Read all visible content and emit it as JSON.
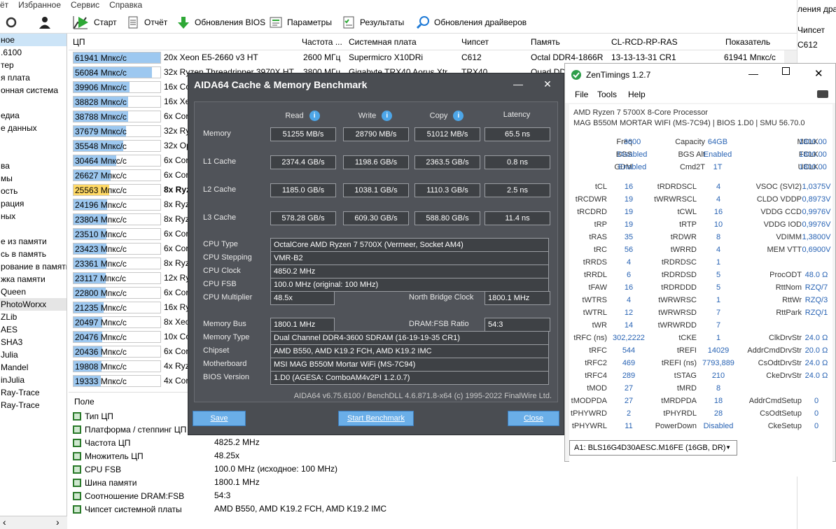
{
  "menu": [
    "ёт",
    "Избранное",
    "Сервис",
    "Справка"
  ],
  "toolbar": [
    {
      "label": "Старт",
      "icon": "play-icon"
    },
    {
      "label": "Отчёт",
      "icon": "report-icon"
    },
    {
      "label": "Обновления BIOS",
      "icon": "download-icon"
    },
    {
      "label": "Параметры",
      "icon": "settings-icon"
    },
    {
      "label": "Результаты",
      "icon": "results-icon"
    },
    {
      "label": "Обновления драйверов",
      "icon": "search-icon"
    }
  ],
  "left_items": [
    {
      "label": "ное",
      "sel": true
    },
    {
      "label": ".6100"
    },
    {
      "label": "тер"
    },
    {
      "label": "я плата"
    },
    {
      "label": "онная система"
    },
    {
      "label": ""
    },
    {
      "label": "едиа"
    },
    {
      "label": "е данных"
    },
    {
      "label": ""
    },
    {
      "label": ""
    },
    {
      "label": "ва"
    },
    {
      "label": "мы"
    },
    {
      "label": "ость"
    },
    {
      "label": "рация"
    },
    {
      "label": "ных"
    },
    {
      "label": ""
    },
    {
      "label": "е из памяти"
    },
    {
      "label": "сь в память"
    },
    {
      "label": "рование в памяти"
    },
    {
      "label": "жка памяти"
    },
    {
      "label": "Queen"
    },
    {
      "label": "PhotoWorxx",
      "hl": true
    },
    {
      "label": "ZLib"
    },
    {
      "label": "AES"
    },
    {
      "label": "SHA3"
    },
    {
      "label": "Julia"
    },
    {
      "label": "Mandel"
    },
    {
      "label": "inJulia"
    },
    {
      "label": "Ray-Trace"
    },
    {
      "label": "Ray-Trace"
    }
  ],
  "grid": {
    "headers": [
      "ЦП",
      "Частота ...",
      "Системная плата",
      "Чипсет",
      "Память",
      "CL-RCD-RP-RAS",
      "Показатель"
    ],
    "rows": [
      {
        "val": "61941 Мпкс/с",
        "frac": 1.0,
        "name": "20x Xeon E5-2660 v3 HT",
        "freq": "2600 МГц",
        "board": "Supermicro X10DRi",
        "chip": "C612",
        "mem": "Octal DDR4-1866R",
        "timing": "13-13-13-31 CR1",
        "score": "61941 Мпкс/с"
      },
      {
        "val": "56084 Мпкс/с",
        "frac": 0.905,
        "name": "32x Ryzen Threadripper 3970X HT",
        "freq": "3800 МГц",
        "board": "Gigabyte TRX40 Aorus Xtr...",
        "chip": "TRX40",
        "mem": "Quad DDR4",
        "timing": "",
        "score": ""
      },
      {
        "val": "39906 Мпкс/с",
        "frac": 0.644,
        "name": "16x Co"
      },
      {
        "val": "38828 Мпкс/с",
        "frac": 0.627,
        "name": "16x Xe"
      },
      {
        "val": "38788 Мпкс/с",
        "frac": 0.626,
        "name": "6x Cor"
      },
      {
        "val": "37679 Мпкс/с",
        "frac": 0.608,
        "name": "32x Ry"
      },
      {
        "val": "35548 Мпкс/с",
        "frac": 0.574,
        "name": "32x Op"
      },
      {
        "val": "30464 Мпкс/с",
        "frac": 0.492,
        "name": "6x Cor"
      },
      {
        "val": "26627 Мпкс/с",
        "frac": 0.43,
        "name": "6x Cor"
      },
      {
        "val": "25563 Мпкс/с",
        "frac": 0.413,
        "name": "8x Ryz",
        "cur": true
      },
      {
        "val": "24196 Мпкс/с",
        "frac": 0.391,
        "name": "8x Ryz"
      },
      {
        "val": "23804 Мпкс/с",
        "frac": 0.384,
        "name": "8x Ryz"
      },
      {
        "val": "23510 Мпкс/с",
        "frac": 0.38,
        "name": "6x Cor"
      },
      {
        "val": "23423 Мпкс/с",
        "frac": 0.378,
        "name": "6x Cor"
      },
      {
        "val": "23361 Мпкс/с",
        "frac": 0.377,
        "name": "8x Ryz"
      },
      {
        "val": "23117 Мпкс/с",
        "frac": 0.373,
        "name": "12x Ry"
      },
      {
        "val": "22800 Мпкс/с",
        "frac": 0.368,
        "name": "6x Cor"
      },
      {
        "val": "21235 Мпкс/с",
        "frac": 0.343,
        "name": "16x Ry"
      },
      {
        "val": "20497 Мпкс/с",
        "frac": 0.331,
        "name": "8x Xeo"
      },
      {
        "val": "20476 Мпкс/с",
        "frac": 0.331,
        "name": "10x Co"
      },
      {
        "val": "20436 Мпкс/с",
        "frac": 0.33,
        "name": "6x Cor"
      },
      {
        "val": "19808 Мпкс/с",
        "frac": 0.32,
        "name": "4x Ryz"
      },
      {
        "val": "19333 Мпкс/с",
        "frac": 0.312,
        "name": "4x Cor"
      }
    ]
  },
  "props": {
    "header": "Поле",
    "rows": [
      {
        "label": "Тип ЦП",
        "value": ""
      },
      {
        "label": "Платформа / степпинг ЦП",
        "value": ""
      },
      {
        "label": "Частота ЦП",
        "value": "4825.2 MHz"
      },
      {
        "label": "Множитель ЦП",
        "value": "48.25x"
      },
      {
        "label": "CPU FSB",
        "value": "100.0 MHz  (исходное: 100 MHz)"
      },
      {
        "label": "Шина памяти",
        "value": "1800.1 MHz"
      },
      {
        "label": "Соотношение DRAM:FSB",
        "value": "54:3"
      },
      {
        "label": "Чипсет системной платы",
        "value": "AMD B550, AMD K19.2 FCH, AMD K19.2 IMC"
      }
    ]
  },
  "right_strip": {
    "top": "ления драй",
    "col": "Чипсет",
    "val": "C612"
  },
  "aida": {
    "title": "AIDA64 Cache & Memory Benchmark",
    "cols": [
      "Read",
      "Write",
      "Copy",
      "Latency"
    ],
    "rows": [
      {
        "label": "Memory",
        "vals": [
          "51255 MB/s",
          "28790 MB/s",
          "51012 MB/s",
          "65.5 ns"
        ]
      },
      {
        "label": "L1 Cache",
        "vals": [
          "2374.4 GB/s",
          "1198.6 GB/s",
          "2363.5 GB/s",
          "0.8 ns"
        ]
      },
      {
        "label": "L2 Cache",
        "vals": [
          "1185.0 GB/s",
          "1038.1 GB/s",
          "1110.3 GB/s",
          "2.5 ns"
        ]
      },
      {
        "label": "L3 Cache",
        "vals": [
          "578.28 GB/s",
          "609.30 GB/s",
          "588.80 GB/s",
          "11.4 ns"
        ]
      }
    ],
    "cpu_type_label": "CPU Type",
    "cpu_type": "OctalCore AMD Ryzen 7 5700X  (Vermeer, Socket AM4)",
    "cpu_step_label": "CPU Stepping",
    "cpu_step": "VMR-B2",
    "cpu_clock_label": "CPU Clock",
    "cpu_clock": "4850.2 MHz",
    "cpu_fsb_label": "CPU FSB",
    "cpu_fsb": "100.0 MHz  (original: 100 MHz)",
    "cpu_mult_label": "CPU Multiplier",
    "cpu_mult": "48.5x",
    "nb_label": "North Bridge Clock",
    "nb": "1800.1 MHz",
    "membus_label": "Memory Bus",
    "membus": "1800.1 MHz",
    "ratio_label": "DRAM:FSB Ratio",
    "ratio": "54:3",
    "memtype_label": "Memory Type",
    "memtype": "Dual Channel DDR4-3600 SDRAM  (16-19-19-35 CR1)",
    "chipset_label": "Chipset",
    "chipset": "AMD B550, AMD K19.2 FCH, AMD K19.2 IMC",
    "mb_label": "Motherboard",
    "mb": "MSI MAG B550M Mortar WiFi (MS-7C94)",
    "bios_label": "BIOS Version",
    "bios": "1.D0  (AGESA: ComboAM4v2PI 1.2.0.7)",
    "footer": "AIDA64 v6.75.6100 / BenchDLL 4.6.871.8-x64  (c) 1995-2022 FinalWire Ltd.",
    "save": "Save",
    "start": "Start Benchmark",
    "close": "Close",
    "win_min": "—",
    "win_close": "✕"
  },
  "zen": {
    "title": "ZenTimings 1.2.7",
    "menu": [
      "File",
      "Tools",
      "Help"
    ],
    "cpu": "AMD Ryzen 7 5700X 8-Core Processor",
    "board": "MAG B550M MORTAR WIFI (MS-7C94) | BIOS 1.D0 | SMU 56.70.0",
    "top": [
      [
        "Freq",
        "3600",
        "Capacity",
        "64GB",
        "MCLK",
        "1800.00"
      ],
      [
        "BGS",
        "Disabled",
        "BGS Alt",
        "Enabled",
        "FCLK",
        "1800.00"
      ],
      [
        "GDM",
        "Enabled",
        "Cmd2T",
        "1T",
        "UCLK",
        "1800.00"
      ]
    ],
    "timings": [
      [
        "tCL",
        "16",
        "tRDRDSCL",
        "4",
        "VSOC (SVI2)",
        "1,0375V"
      ],
      [
        "tRCDWR",
        "19",
        "tWRWRSCL",
        "4",
        "CLDO VDDP",
        "0,8973V"
      ],
      [
        "tRCDRD",
        "19",
        "tCWL",
        "16",
        "VDDG CCD",
        "0,9976V"
      ],
      [
        "tRP",
        "19",
        "tRTP",
        "10",
        "VDDG IOD",
        "0,9976V"
      ],
      [
        "tRAS",
        "35",
        "tRDWR",
        "8",
        "VDIMM",
        "1,3800V"
      ],
      [
        "tRC",
        "56",
        "tWRRD",
        "4",
        "MEM VTT",
        "0,6900V"
      ],
      [
        "tRRDS",
        "4",
        "tRDRDSC",
        "1",
        "",
        ""
      ],
      [
        "tRRDL",
        "6",
        "tRDRDSD",
        "5",
        "ProcODT",
        "48.0 Ω"
      ],
      [
        "tFAW",
        "16",
        "tRDRDDD",
        "5",
        "RttNom",
        "RZQ/7"
      ],
      [
        "tWTRS",
        "4",
        "tWRWRSC",
        "1",
        "RttWr",
        "RZQ/3"
      ],
      [
        "tWTRL",
        "12",
        "tWRWRSD",
        "7",
        "RttPark",
        "RZQ/1"
      ],
      [
        "tWR",
        "14",
        "tWRWRDD",
        "7",
        "",
        ""
      ],
      [
        "tRFC (ns)",
        "302,2222",
        "tCKE",
        "1",
        "ClkDrvStr",
        "24.0 Ω"
      ],
      [
        "tRFC",
        "544",
        "tREFI",
        "14029",
        "AddrCmdDrvStr",
        "20.0 Ω"
      ],
      [
        "tRFC2",
        "469",
        "tREFI (ns)",
        "7793,889",
        "CsOdtDrvStr",
        "24.0 Ω"
      ],
      [
        "tRFC4",
        "289",
        "tSTAG",
        "210",
        "CkeDrvStr",
        "24.0 Ω"
      ],
      [
        "tMOD",
        "27",
        "tMRD",
        "8",
        "",
        ""
      ],
      [
        "tMODPDA",
        "27",
        "tMRDPDA",
        "18",
        "AddrCmdSetup",
        "0"
      ],
      [
        "tPHYWRD",
        "2",
        "tPHYRDL",
        "28",
        "CsOdtSetup",
        "0"
      ],
      [
        "tPHYWRL",
        "11",
        "PowerDown",
        "Disabled",
        "CkeSetup",
        "0"
      ]
    ],
    "dimm": "A1: BLS16G4D30AESC.M16FE (16GB, DR)"
  }
}
